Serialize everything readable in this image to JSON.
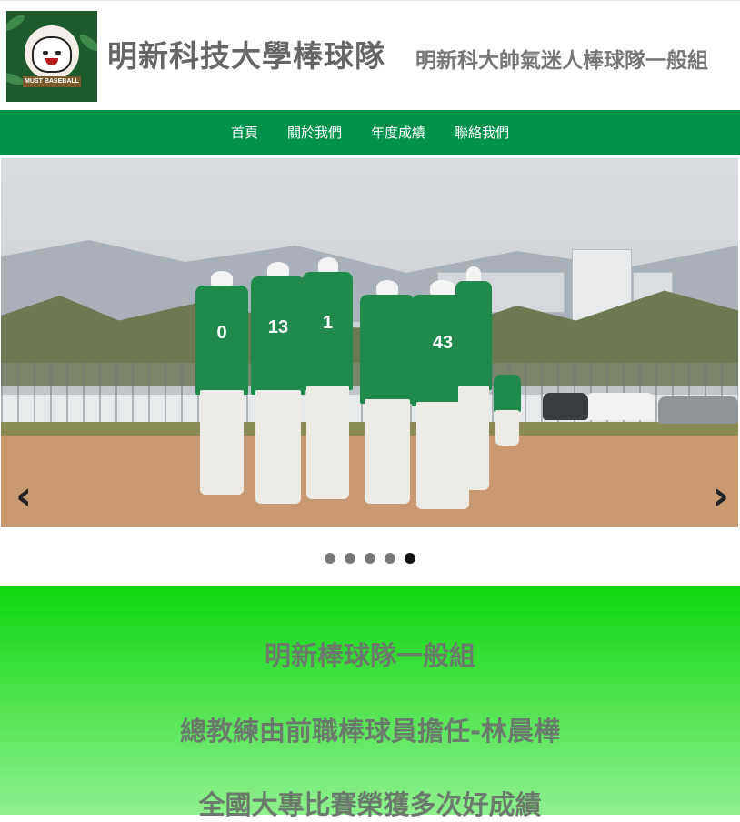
{
  "header": {
    "logo_text": "MUST BASEBALL",
    "title": "明新科技大學棒球隊",
    "subtitle": "明新科大帥氣迷人棒球隊一般組"
  },
  "nav": {
    "items": [
      "首頁",
      "關於我們",
      "年度成績",
      "聯絡我們"
    ]
  },
  "slider": {
    "player_numbers": [
      "0",
      "13",
      "1",
      "43"
    ],
    "prev_icon": "chevron-left-icon",
    "next_icon": "chevron-right-icon",
    "slide_count": 5,
    "active_slide": 5
  },
  "intro": {
    "lines": [
      "明新棒球隊一般組",
      "總教練由前職棒球員擔任-林晨樺",
      "全國大專比賽榮獲多次好成績"
    ]
  },
  "colors": {
    "nav_bg": "#00924a",
    "intro_top": "#0dd60d",
    "intro_bottom": "#8ff08f"
  }
}
